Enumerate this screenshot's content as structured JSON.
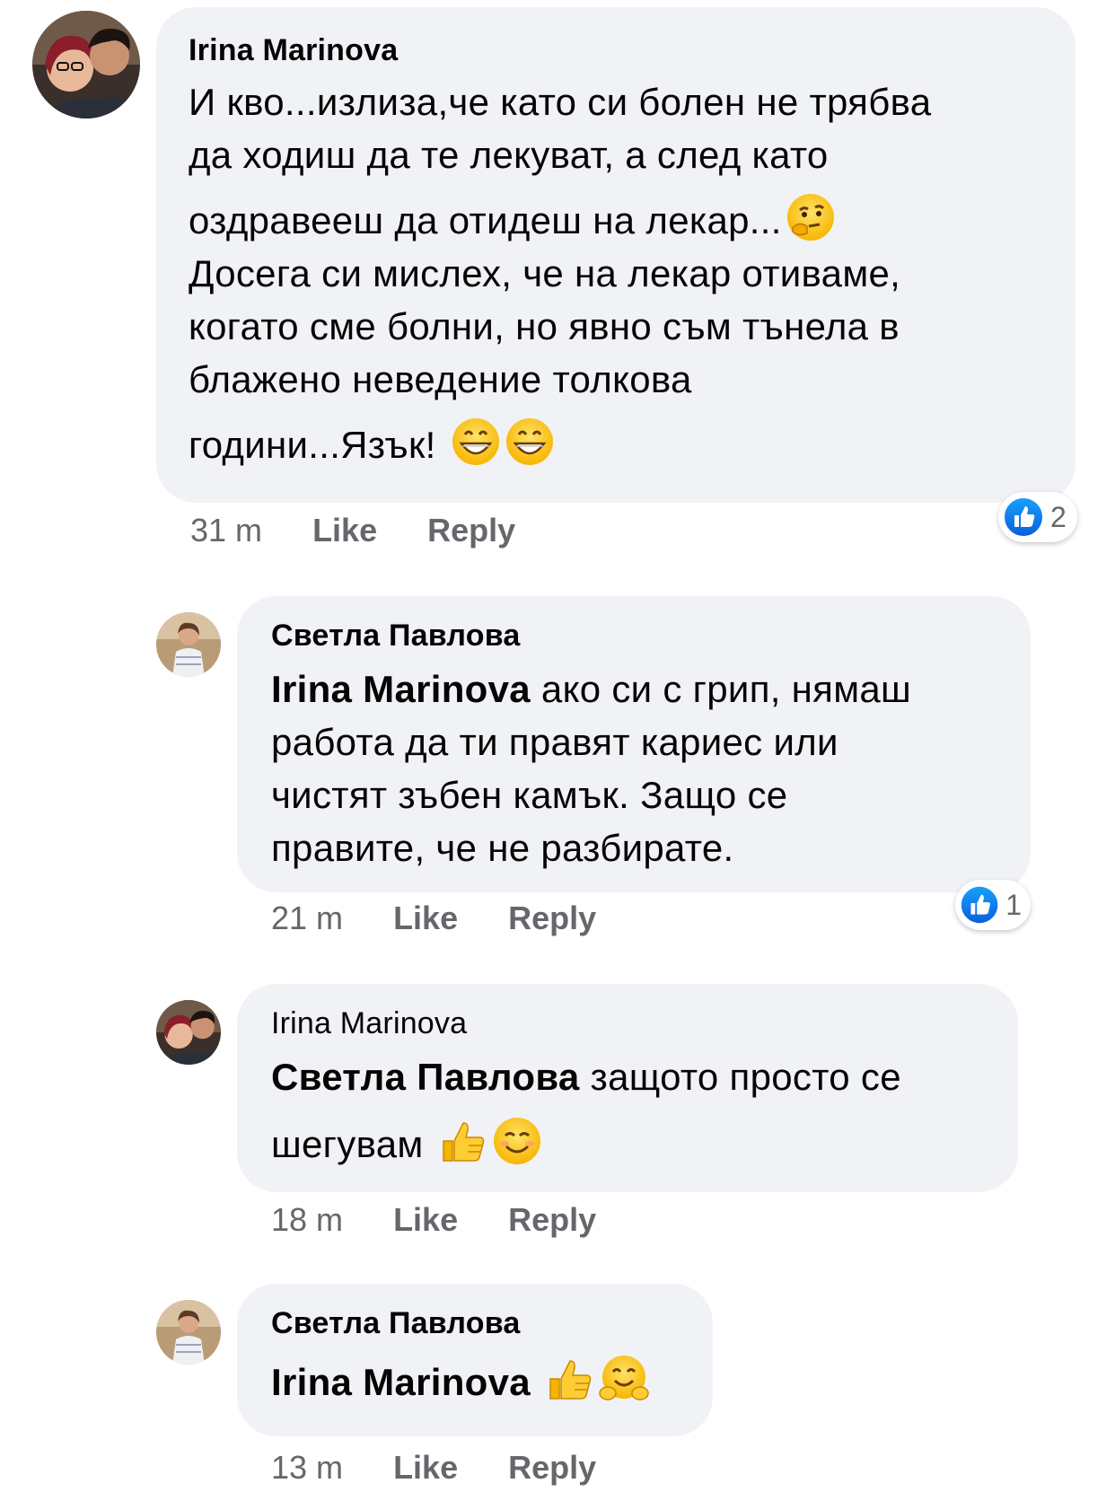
{
  "comments": [
    {
      "author": "Irina Marinova",
      "lines": [
        "И кво...излиза,че като си болен не трябва",
        "да ходиш да те лекуват, а след като",
        "оздравееш да отидеш на лекар...",
        "Досега си мислех, че на лекар отиваме,",
        "когато сме болни, но явно съм тънела в",
        "блажено неведение толкова",
        "години...Язък!"
      ],
      "emojis": [
        "thinking-face",
        "grinning-face",
        "grinning-face"
      ],
      "time": "31 m",
      "like_label": "Like",
      "reply_label": "Reply",
      "reaction_count": "2"
    },
    {
      "author": "Светла Павлова",
      "mention": "Irina Marinova",
      "lines": [
        " ако си с грип, нямаш",
        "работа да ти правят кариес или",
        "чистят зъбен камък. Защо се",
        "правите, че не разбирате."
      ],
      "time": "21 m",
      "like_label": "Like",
      "reply_label": "Reply",
      "reaction_count": "1"
    },
    {
      "author": "Irina Marinova",
      "mention": "Светла Павлова",
      "lines": [
        " защото просто се",
        "шегувам"
      ],
      "emojis": [
        "thumbs-up",
        "smiling-face"
      ],
      "time": "18 m",
      "like_label": "Like",
      "reply_label": "Reply"
    },
    {
      "author": "Светла Павлова",
      "mention": "Irina Marinova",
      "emojis": [
        "thumbs-up",
        "hugging-face"
      ],
      "time": "13 m",
      "like_label": "Like",
      "reply_label": "Reply"
    }
  ],
  "colors": {
    "bubble": "#f0f2f5",
    "meta": "#65676b",
    "like_blue": "#1877f2"
  }
}
